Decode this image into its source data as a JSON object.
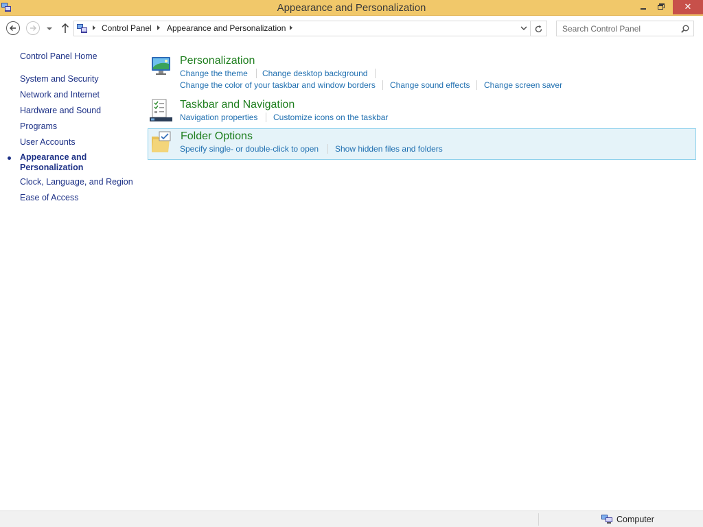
{
  "window": {
    "title": "Appearance and Personalization",
    "close_glyph": "✕"
  },
  "address": {
    "breadcrumbs": [
      "Control Panel",
      "Appearance and Personalization"
    ]
  },
  "search": {
    "placeholder": "Search Control Panel"
  },
  "sidebar": {
    "items": [
      {
        "label": "Control Panel Home"
      },
      {
        "label": "System and Security"
      },
      {
        "label": "Network and Internet"
      },
      {
        "label": "Hardware and Sound"
      },
      {
        "label": "Programs"
      },
      {
        "label": "User Accounts"
      },
      {
        "label": "Appearance and Personalization",
        "current": true
      },
      {
        "label": "Clock, Language, and Region"
      },
      {
        "label": "Ease of Access"
      }
    ]
  },
  "categories": [
    {
      "title": "Personalization",
      "icon": "personalization-monitor-icon",
      "links": [
        "Change the theme",
        "Change desktop background",
        "Change the color of your taskbar and window borders",
        "Change sound effects",
        "Change screen saver"
      ]
    },
    {
      "title": "Taskbar and Navigation",
      "icon": "taskbar-checklist-icon",
      "links": [
        "Navigation properties",
        "Customize icons on the taskbar"
      ]
    },
    {
      "title": "Folder Options",
      "icon": "folder-options-icon",
      "highlighted": true,
      "links": [
        "Specify single- or double-click to open",
        "Show hidden files and folders"
      ]
    }
  ],
  "statusbar": {
    "text": "Computer"
  },
  "colors": {
    "titlebar": "#f1c86a",
    "close_button": "#c7504a",
    "category_title": "#1e7e1e",
    "link": "#1f6fb0",
    "nav_link": "#1e3287",
    "highlight_bg": "#e5f3f9",
    "highlight_border": "#8fd1ec"
  }
}
